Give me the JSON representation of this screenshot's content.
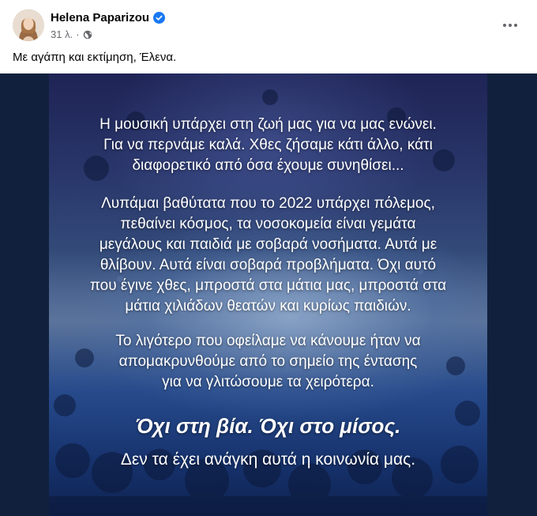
{
  "post": {
    "author": "Helena Paparizou",
    "time": "31 λ.",
    "caption": "Με αγάπη και εκτίμηση, Έλενα.",
    "more_label": "More options"
  },
  "image_text": {
    "para1": [
      "Η μουσική υπάρχει στη ζωή μας για να μας ενώνει.",
      "Για να περνάμε καλά. Χθες ζήσαμε κάτι άλλο, κάτι",
      "διαφορετικό από όσα έχουμε συνηθίσει..."
    ],
    "para2": [
      "Λυπάμαι βαθύτατα που το 2022 υπάρχει πόλεμος,",
      "πεθαίνει κόσμος, τα νοσοκομεία είναι γεμάτα",
      "μεγάλους και παιδιά με σοβαρά νοσήματα. Αυτά με",
      "θλίβουν. Αυτά είναι σοβαρά προβλήματα. Όχι αυτό",
      "που έγινε χθες, μπροστά στα μάτια μας, μπροστά στα",
      "μάτια χιλιάδων θεατών και κυρίως παιδιών."
    ],
    "para3": [
      "Το λιγότερο που οφείλαμε να κάνουμε ήταν να",
      "απομακρυνθούμε από το σημείο της έντασης",
      "για να γλιτώσουμε τα χειρότερα."
    ],
    "slogan": "Όχι στη βία. Όχι στο μίσος.",
    "closing": "Δεν τα έχει ανάγκη αυτά η κοινωνία μας."
  },
  "colors": {
    "verified": "#1877f2",
    "meta": "#65676b",
    "text": "#050505"
  },
  "icons": [
    "verified-badge-icon",
    "globe-icon",
    "more-options-icon"
  ]
}
